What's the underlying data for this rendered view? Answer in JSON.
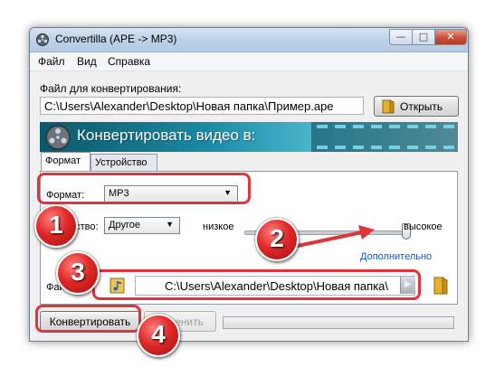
{
  "window": {
    "title": "Convertilla  (APE -> MP3)",
    "controls": {
      "minimize": "—",
      "maximize": "□",
      "close": "✕"
    }
  },
  "menu": [
    "Файл",
    "Вид",
    "Справка"
  ],
  "input": {
    "label": "Файл для конвертирования:",
    "path": "C:\\Users\\Alexander\\Desktop\\Новая папка\\Пример.ape",
    "open_button": "Открыть"
  },
  "banner": {
    "title": "Конвертировать видео в:"
  },
  "tabs": [
    {
      "label": "Формат",
      "active": true
    },
    {
      "label": "Устройство",
      "active": false
    }
  ],
  "format": {
    "label": "Формат:",
    "value": "MP3"
  },
  "quality": {
    "label_partial": "ество:",
    "value": "Другое",
    "low_label": "низкое",
    "high_label": "высокое",
    "slider_level": 1.0,
    "more_link": "Дополнительно"
  },
  "output": {
    "label": "Файл",
    "path": "C:\\Users\\Alexander\\Desktop\\Новая папка\\"
  },
  "actions": {
    "convert_button": "Конвертировать",
    "cancel_partial": "енить",
    "progress": 0
  },
  "annotations": [
    "1",
    "2",
    "3",
    "4"
  ],
  "colors": {
    "callout": "#e0343a",
    "banner": "#1a8aa4",
    "link": "#1a58b0"
  }
}
